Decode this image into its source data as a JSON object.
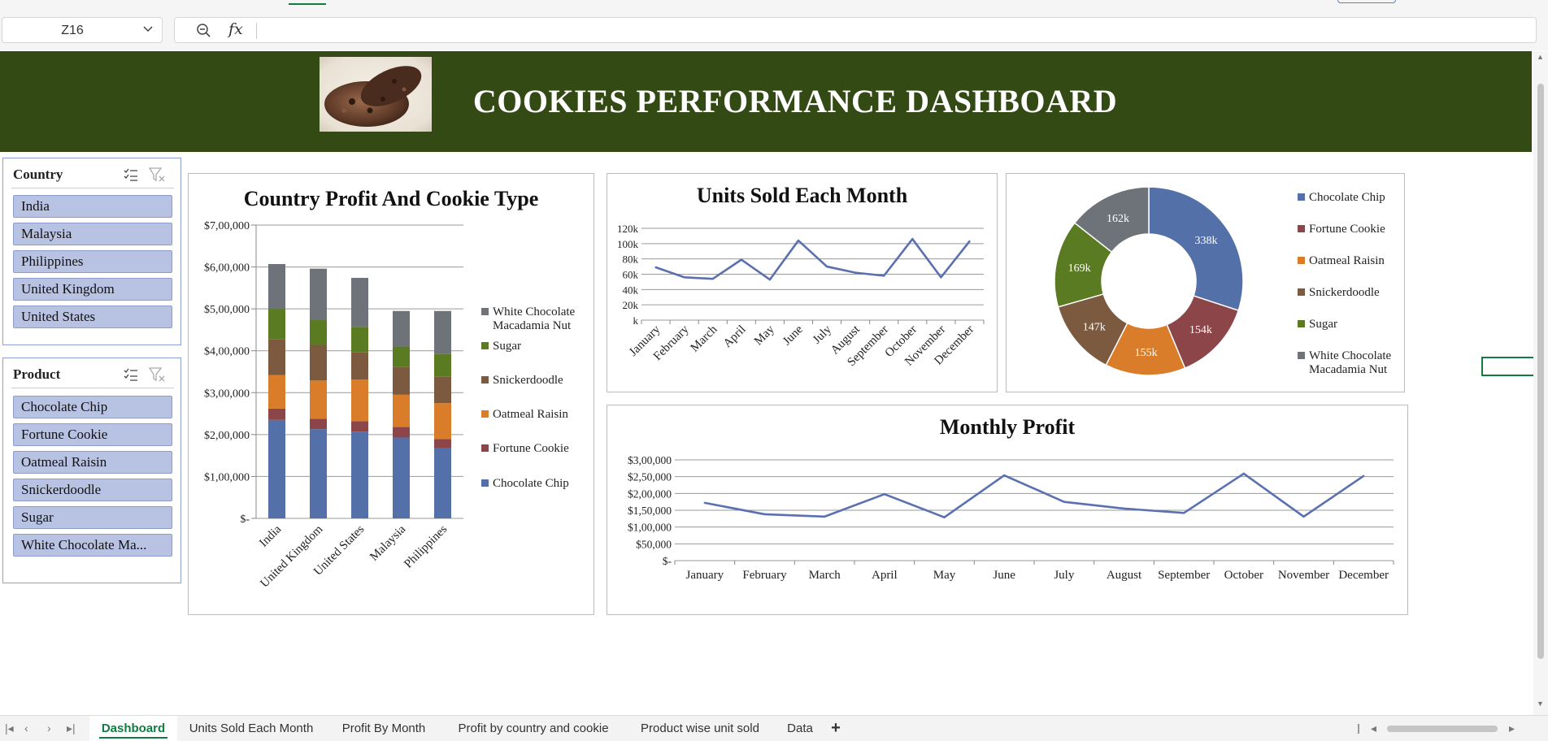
{
  "name_box": {
    "value": "Z16"
  },
  "formula_bar": {
    "fx_label": "fx",
    "value": ""
  },
  "dashboard": {
    "title": "COOKIES PERFORMANCE DASHBOARD"
  },
  "slicers": {
    "country": {
      "title": "Country",
      "items": [
        "India",
        "Malaysia",
        "Philippines",
        "United Kingdom",
        "United States"
      ]
    },
    "product": {
      "title": "Product",
      "items": [
        "Chocolate Chip",
        "Fortune Cookie",
        "Oatmeal Raisin",
        "Snickerdoodle",
        "Sugar",
        "White Chocolate Ma..."
      ]
    }
  },
  "colors": {
    "banner": "#344a14",
    "series": [
      "#5470a8",
      "#8c464a",
      "#d97d2b",
      "#7b5a40",
      "#5b7b23",
      "#6d7378"
    ],
    "line": "#5a70b0",
    "slicer_item": "#b8c2e2",
    "active_tab": "#107c41"
  },
  "chart_data": [
    {
      "type": "bar",
      "stacked": true,
      "title": "Country Profit And Cookie Type",
      "categories": [
        "India",
        "United Kingdom",
        "United States",
        "Malaysia",
        "Philippines"
      ],
      "y_ticks": [
        "$-",
        "$1,00,000",
        "$2,00,000",
        "$3,00,000",
        "$4,00,000",
        "$5,00,000",
        "$6,00,000",
        "$7,00,000"
      ],
      "ylim": [
        0,
        700000
      ],
      "legend": "right",
      "legend_labels": [
        [
          "White Chocolate",
          "Macadamia Nut"
        ],
        [
          "Sugar"
        ],
        [
          "Snickerdoodle"
        ],
        [
          "Oatmeal Raisin"
        ],
        [
          "Fortune Cookie"
        ],
        [
          "Chocolate Chip"
        ]
      ],
      "series": [
        {
          "name": "Chocolate Chip",
          "values": [
            235000,
            213000,
            207000,
            193000,
            167000
          ]
        },
        {
          "name": "Fortune Cookie",
          "values": [
            27000,
            25000,
            25000,
            25000,
            22000
          ]
        },
        {
          "name": "Oatmeal Raisin",
          "values": [
            80000,
            91000,
            99000,
            77000,
            86000
          ]
        },
        {
          "name": "Snickerdoodle",
          "values": [
            86000,
            85000,
            65000,
            67000,
            63000
          ]
        },
        {
          "name": "Sugar",
          "values": [
            72000,
            60000,
            61000,
            48000,
            54000
          ]
        },
        {
          "name": "White Chocolate Macadamia Nut",
          "values": [
            107000,
            122000,
            117000,
            85000,
            103000
          ]
        }
      ]
    },
    {
      "type": "line",
      "title": "Units Sold Each Month",
      "categories": [
        "January",
        "February",
        "March",
        "April",
        "May",
        "June",
        "July",
        "August",
        "September",
        "October",
        "November",
        "December"
      ],
      "y_ticks": [
        "k",
        "20k",
        "40k",
        "60k",
        "80k",
        "100k",
        "120k"
      ],
      "ylim": [
        0,
        120000
      ],
      "series": [
        {
          "values": [
            69000,
            56000,
            54000,
            79000,
            53000,
            104000,
            70000,
            62000,
            58000,
            106000,
            56000,
            103000
          ]
        }
      ]
    },
    {
      "type": "pie",
      "donut": true,
      "labels": [
        "Chocolate Chip",
        "Fortune Cookie",
        "Oatmeal Raisin",
        "Snickerdoodle",
        "Sugar",
        "White Chocolate Macadamia Nut"
      ],
      "legend_labels": [
        [
          "Chocolate Chip"
        ],
        [
          "Fortune Cookie"
        ],
        [
          "Oatmeal Raisin"
        ],
        [
          "Snickerdoodle"
        ],
        [
          "Sugar"
        ],
        [
          "White Chocolate",
          "Macadamia Nut"
        ]
      ],
      "values": [
        338000,
        154000,
        155000,
        147000,
        169000,
        162000
      ],
      "data_labels": [
        "338k",
        "154k",
        "155k",
        "147k",
        "169k",
        "162k"
      ],
      "legend": "right"
    },
    {
      "type": "line",
      "title": "Monthly Profit",
      "categories": [
        "January",
        "February",
        "March",
        "April",
        "May",
        "June",
        "July",
        "August",
        "September",
        "October",
        "November",
        "December"
      ],
      "y_ticks": [
        "$-",
        "$50,000",
        "$1,00,000",
        "$1,50,000",
        "$2,00,000",
        "$2,50,000",
        "$3,00,000"
      ],
      "ylim": [
        0,
        300000
      ],
      "series": [
        {
          "values": [
            172000,
            138000,
            131000,
            198000,
            129000,
            254000,
            175000,
            155000,
            142000,
            259000,
            131000,
            252000
          ]
        }
      ]
    }
  ],
  "sheet_tabs": [
    {
      "label": "Dashboard",
      "active": true
    },
    {
      "label": "Units Sold Each Month",
      "active": false
    },
    {
      "label": "Profit By Month",
      "active": false
    },
    {
      "label": "Profit by country and cookie",
      "active": false
    },
    {
      "label": "Product wise unit sold",
      "active": false
    },
    {
      "label": "Data",
      "active": false
    }
  ],
  "add_sheet": "+"
}
